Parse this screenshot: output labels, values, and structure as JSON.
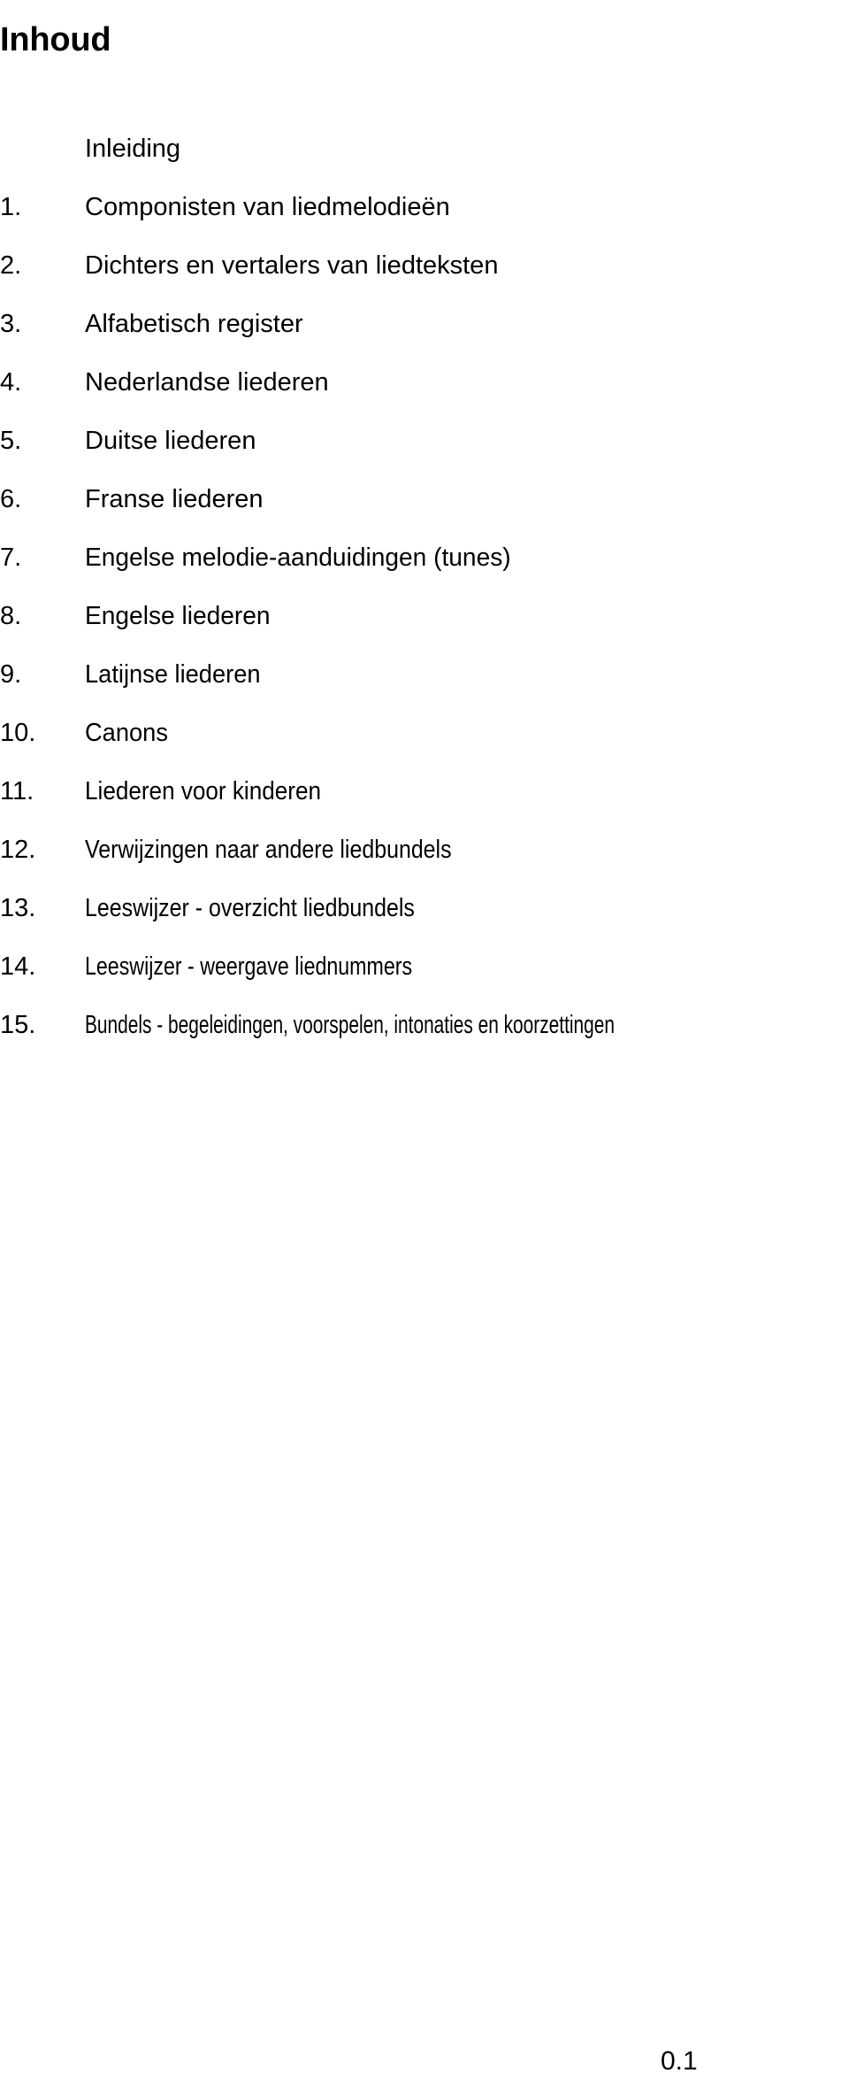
{
  "document": {
    "title": "Inhoud"
  },
  "toc": {
    "items": [
      {
        "number": "",
        "label": "Inleiding"
      },
      {
        "number": "1.",
        "label": "Componisten van liedmelodieën"
      },
      {
        "number": "2.",
        "label": "Dichters en vertalers van liedteksten"
      },
      {
        "number": "3.",
        "label": "Alfabetisch register"
      },
      {
        "number": "4.",
        "label": "Nederlandse liederen"
      },
      {
        "number": "5.",
        "label": "Duitse liederen"
      },
      {
        "number": "6.",
        "label": "Franse liederen"
      },
      {
        "number": "7.",
        "label": "Engelse melodie-aanduidingen (tunes)"
      },
      {
        "number": "8.",
        "label": "Engelse liederen"
      },
      {
        "number": "9.",
        "label": "Latijnse liederen"
      },
      {
        "number": "10.",
        "label": "Canons"
      },
      {
        "number": "11.",
        "label": "Liederen voor kinderen"
      },
      {
        "number": "12.",
        "label": "Verwijzingen naar andere liedbundels"
      },
      {
        "number": "13.",
        "label": "Leeswijzer - overzicht liedbundels"
      },
      {
        "number": "14.",
        "label": "Leeswijzer - weergave liednummers"
      },
      {
        "number": "15.",
        "label": "Bundels - begeleidingen, voorspelen, intonaties en koorzettingen"
      }
    ]
  },
  "footer": {
    "page_number": "0.1"
  },
  "colors": {
    "text": "#000000",
    "background": "#ffffff"
  }
}
